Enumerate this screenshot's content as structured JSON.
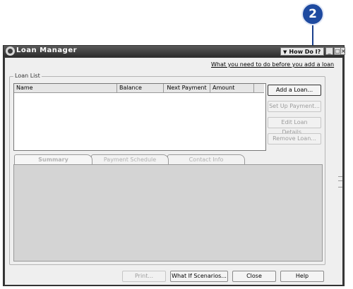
{
  "callout": {
    "number": "2"
  },
  "window": {
    "title": "Loan Manager",
    "howdoi_label": "How Do I?",
    "controls": {
      "minimize": "_",
      "restore": "□",
      "close": "×"
    }
  },
  "top_link": "What you need to do before you add a loan",
  "loan_list": {
    "label": "Loan List",
    "columns": [
      "Name",
      "Balance",
      "Next Payment",
      "Amount"
    ]
  },
  "side_buttons": {
    "add_loan": "Add a Loan...",
    "set_up_payment": "Set Up Payment...",
    "edit_loan_details": "Edit Loan Details...",
    "remove_loan": "Remove Loan..."
  },
  "tabs": [
    "Summary",
    "Payment Schedule",
    "Contact Info"
  ],
  "bottom_buttons": {
    "print": "Print...",
    "what_if": "What If Scenarios...",
    "close": "Close",
    "help": "Help"
  }
}
